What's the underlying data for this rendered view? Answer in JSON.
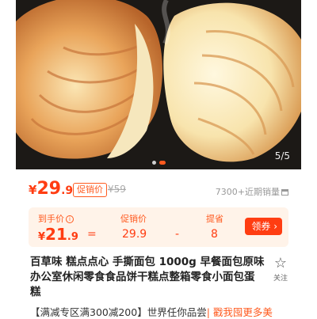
{
  "gallery": {
    "counter": "5/5",
    "total_dots": 2,
    "active_dot": 2
  },
  "price": {
    "currency": "¥",
    "integer": "29",
    "decimal": ".9",
    "promo_tag": "促销价",
    "original": "¥59",
    "sales": "7300+近期销量"
  },
  "calc": {
    "after_label": "到手价",
    "after_currency": "¥",
    "after_integer": "21",
    "after_decimal": ".9",
    "equals": "=",
    "promo_label": "促销价",
    "promo_value": "29.9",
    "minus": "-",
    "discount_label": "提省",
    "discount_value": "8",
    "coupon_button": "领券 ›"
  },
  "product": {
    "title": "百草味 糕点点心 手撕面包 1000g 早餐面包原味办公室休闲零食食品饼干糕点整箱零食小面包蛋糕",
    "follow_label": "关注"
  },
  "promo_line": {
    "text": "【满减专区满300减200】世界任你品尝",
    "link": "| 戳我囤更多美"
  },
  "colors": {
    "accent": "#ff3d12",
    "accent_light": "#fff3e9"
  }
}
